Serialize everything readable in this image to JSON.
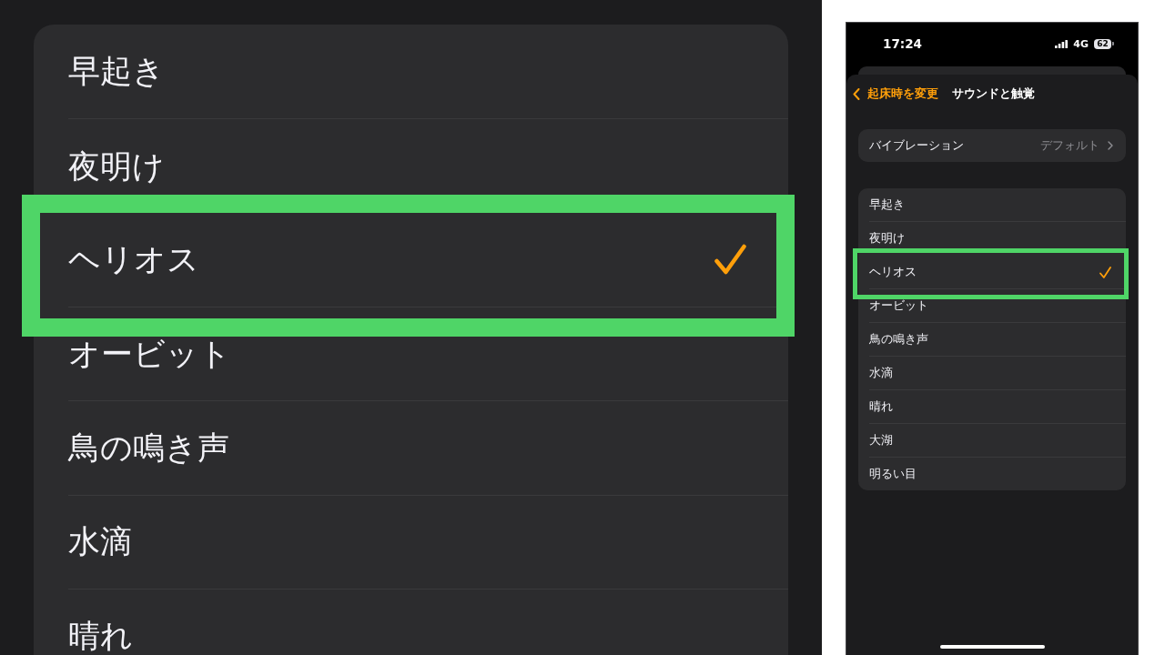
{
  "zoom_view": {
    "items": [
      {
        "label": "早起き",
        "selected": false,
        "highlighted": false
      },
      {
        "label": "夜明け",
        "selected": false,
        "highlighted": false
      },
      {
        "label": "ヘリオス",
        "selected": true,
        "highlighted": true
      },
      {
        "label": "オービット",
        "selected": false,
        "highlighted": false
      },
      {
        "label": "鳥の鳴き声",
        "selected": false,
        "highlighted": false
      },
      {
        "label": "水滴",
        "selected": false,
        "highlighted": false
      },
      {
        "label": "晴れ",
        "selected": false,
        "highlighted": false
      }
    ]
  },
  "phone": {
    "status_bar": {
      "time": "17:24",
      "network": "4G",
      "battery": "62"
    },
    "nav": {
      "back": "起床時を変更",
      "title": "サウンドと触覚"
    },
    "vibration": {
      "label": "バイブレーション",
      "value": "デフォルト"
    },
    "sounds": [
      {
        "label": "早起き",
        "selected": false,
        "highlighted": false
      },
      {
        "label": "夜明け",
        "selected": false,
        "highlighted": false
      },
      {
        "label": "ヘリオス",
        "selected": true,
        "highlighted": true
      },
      {
        "label": "オービット",
        "selected": false,
        "highlighted": false
      },
      {
        "label": "鳥の鳴き声",
        "selected": false,
        "highlighted": false
      },
      {
        "label": "水滴",
        "selected": false,
        "highlighted": false
      },
      {
        "label": "晴れ",
        "selected": false,
        "highlighted": false
      },
      {
        "label": "大湖",
        "selected": false,
        "highlighted": false
      },
      {
        "label": "明るい目",
        "selected": false,
        "highlighted": false
      }
    ]
  }
}
